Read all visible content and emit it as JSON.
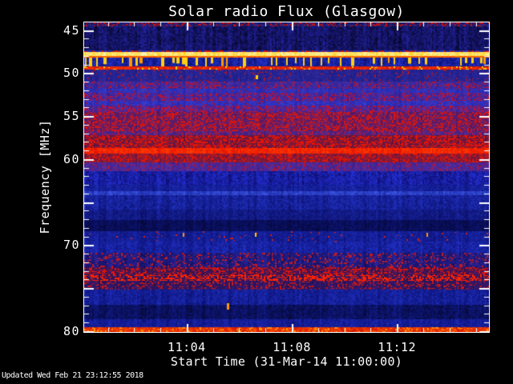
{
  "footer": {
    "updated": "Updated Wed Feb 21 23:12:55 2018"
  },
  "chart_data": {
    "type": "heatmap",
    "title": "Solar radio Flux (Glasgow)",
    "xlabel": "Start Time (31-Mar-14 11:00:00)",
    "ylabel": "Frequency [MHz]",
    "background": "#000000",
    "frame_color": "#ffffff",
    "text_color": "#ffffff",
    "grid": false,
    "x_unit_minutes_after": "11:00",
    "xlim": [
      0.1,
      15.5
    ],
    "ylim": [
      44.1,
      80.1
    ],
    "x_major_ticks": [
      {
        "t": 4,
        "label": "11:04"
      },
      {
        "t": 8,
        "label": "11:08"
      },
      {
        "t": 12,
        "label": "11:12"
      }
    ],
    "x_minor_step_min": 1,
    "y_labeled_ticks": [
      45,
      50,
      55,
      60,
      70,
      80
    ],
    "y_major_step": 5,
    "y_minor_step": 1,
    "bands": [
      {
        "f0": 44.1,
        "f1": 44.6,
        "base": "#15134e",
        "alt": "#28289c",
        "speckle": "#c01212",
        "density": 0.45,
        "sw": 3,
        "sh": 2
      },
      {
        "f0": 44.6,
        "f1": 47.4,
        "base": "#070730",
        "alt": "#21219c",
        "density": 0
      },
      {
        "f0": 47.4,
        "f1": 47.62,
        "base": "#1b2390",
        "alt": "#2a35c0",
        "speckle": "#cc1a08",
        "density": 0.5,
        "sw": 3,
        "sh": 2
      },
      {
        "f0": 47.62,
        "f1": 48.05,
        "base": "#ffd012",
        "alt": "#fff7c2",
        "density": 0
      },
      {
        "f0": 48.05,
        "f1": 48.25,
        "base": "#f07f00",
        "alt": "#ff4d00",
        "density": 0
      },
      {
        "f0": 48.25,
        "f1": 49.3,
        "type": "dashes",
        "base": "#2433cf",
        "alt": "#0c1070",
        "dash": "#ffcf10",
        "dash2": "#ff9800",
        "density": 0.3
      },
      {
        "f0": 49.3,
        "f1": 49.62,
        "base": "#cf1505",
        "alt": "#ff3a00",
        "speckle": "#ffd400",
        "density": 0.12,
        "sw": 3,
        "sh": 3
      },
      {
        "f0": 49.62,
        "f1": 51.05,
        "base": "#191c86",
        "alt": "#332a9e",
        "speckle": "#a01830",
        "density": 0.1,
        "sw": 2,
        "sh": 2
      },
      {
        "f0": 51.05,
        "f1": 51.9,
        "base": "#2c2194",
        "alt": "#4930aa",
        "speckle": "#b01535",
        "density": 0.3,
        "sw": 2,
        "sh": 2
      },
      {
        "f0": 51.9,
        "f1": 52.35,
        "base": "#2226ae",
        "alt": "#3a3ac4",
        "speckle": "#8c1850",
        "density": 0.12,
        "sw": 2,
        "sh": 2
      },
      {
        "f0": 52.35,
        "f1": 53.3,
        "base": "#321f96",
        "alt": "#5030a8",
        "speckle": "#b81332",
        "density": 0.35,
        "sw": 2,
        "sh": 2
      },
      {
        "f0": 53.3,
        "f1": 53.8,
        "base": "#2326b2",
        "alt": "#3c3cc8",
        "speckle": "#8c1850",
        "density": 0.12,
        "sw": 2,
        "sh": 2
      },
      {
        "f0": 53.8,
        "f1": 54.6,
        "base": "#3a1d90",
        "alt": "#5c2f9e",
        "speckle": "#c01230",
        "density": 0.38,
        "sw": 2,
        "sh": 2
      },
      {
        "f0": 54.6,
        "f1": 56.8,
        "base": "#4c1666",
        "alt": "#6e2470",
        "speckle": "#d01616",
        "density": 0.5,
        "sw": 2,
        "sh": 2
      },
      {
        "f0": 56.8,
        "f1": 57.3,
        "base": "#3c1d80",
        "alt": "#5a2d90",
        "speckle": "#c01430",
        "density": 0.3,
        "sw": 2,
        "sh": 2
      },
      {
        "f0": 57.3,
        "f1": 58.75,
        "base": "#5c1242",
        "alt": "#801c3e",
        "speckle": "#e01408",
        "density": 0.55,
        "sw": 2,
        "sh": 2
      },
      {
        "f0": 58.75,
        "f1": 59.4,
        "base": "#e51200",
        "alt": "#ff3d00",
        "density": 0
      },
      {
        "f0": 59.4,
        "f1": 60.4,
        "base": "#6e1238",
        "alt": "#93203c",
        "speckle": "#e01408",
        "density": 0.4,
        "sw": 2,
        "sh": 2
      },
      {
        "f0": 60.4,
        "f1": 61.45,
        "base": "#3c2090",
        "alt": "#5a2f9c",
        "speckle": "#b01535",
        "density": 0.18,
        "sw": 2,
        "sh": 2
      },
      {
        "f0": 61.45,
        "f1": 63.05,
        "base": "#2430d6",
        "alt": "#0d0d70",
        "density": 0
      },
      {
        "f0": 63.05,
        "f1": 63.8,
        "base": "#1d2cb4",
        "alt": "#0e1582",
        "density": 0
      },
      {
        "f0": 63.8,
        "f1": 64.2,
        "base": "#3e55e4",
        "alt": "#1a2aa6",
        "density": 0
      },
      {
        "f0": 64.2,
        "f1": 65.9,
        "base": "#2030be",
        "alt": "#0d1478",
        "density": 0
      },
      {
        "f0": 65.9,
        "f1": 67.1,
        "base": "#19259e",
        "alt": "#0a0f6a",
        "density": 0
      },
      {
        "f0": 67.1,
        "f1": 68.45,
        "base": "#0d1472",
        "alt": "#05083e",
        "density": 0
      },
      {
        "f0": 68.45,
        "f1": 69.6,
        "base": "#1c2ab2",
        "alt": "#0d1278",
        "speckle": "#d02010",
        "density": 0.035,
        "sw": 2,
        "sh": 4
      },
      {
        "f0": 69.6,
        "f1": 70.95,
        "base": "#2130c4",
        "alt": "#0e147e",
        "density": 0
      },
      {
        "f0": 70.95,
        "f1": 72.6,
        "base": "#2c249e",
        "alt": "#121060",
        "speckle": "#c41a20",
        "density": 0.22,
        "sw": 2,
        "sh": 3
      },
      {
        "f0": 72.6,
        "f1": 73.45,
        "base": "#54195a",
        "alt": "#2e1150",
        "speckle": "#da1410",
        "density": 0.45,
        "sw": 2,
        "sh": 3
      },
      {
        "f0": 73.45,
        "f1": 74.2,
        "base": "#461a64",
        "alt": "#2a1050",
        "speckle": "#ff2200",
        "density": 0.6,
        "sw": 3,
        "sh": 4
      },
      {
        "f0": 74.2,
        "f1": 75.2,
        "base": "#3c1b74",
        "alt": "#221054",
        "speckle": "#c41818",
        "density": 0.3,
        "sw": 2,
        "sh": 3
      },
      {
        "f0": 75.2,
        "f1": 77.0,
        "base": "#1d2cb8",
        "alt": "#0c1276",
        "density": 0
      },
      {
        "f0": 77.0,
        "f1": 78.7,
        "base": "#111a86",
        "alt": "#05093c",
        "density": 0
      },
      {
        "f0": 78.7,
        "f1": 79.55,
        "base": "#1c2ab4",
        "alt": "#0c117a",
        "density": 0
      },
      {
        "f0": 79.55,
        "f1": 80.1,
        "base": "#d01200",
        "alt": "#ff5500",
        "speckle": "#ff9500",
        "density": 0.15,
        "sw": 4,
        "sh": 2
      }
    ],
    "spots": [
      {
        "t": 6.62,
        "f": 50.45,
        "color": "#ffd400",
        "w": 3,
        "h": 5
      },
      {
        "t": 3.85,
        "f": 68.75,
        "color": "#ff9800",
        "w": 2,
        "h": 5
      },
      {
        "t": 6.59,
        "f": 68.75,
        "color": "#ffd400",
        "w": 2,
        "h": 5
      },
      {
        "t": 13.12,
        "f": 68.75,
        "color": "#ff9800",
        "w": 2,
        "h": 5
      },
      {
        "t": 5.52,
        "f": 77.15,
        "color": "#ff9800",
        "w": 3,
        "h": 8
      }
    ]
  }
}
